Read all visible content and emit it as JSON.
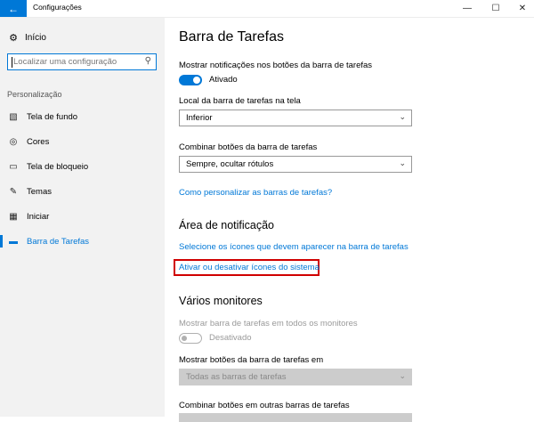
{
  "window": {
    "title": "Configurações",
    "back_icon": "←",
    "min_icon": "—",
    "max_icon": "☐",
    "close_icon": "✕"
  },
  "sidebar": {
    "home_label": "Início",
    "home_icon": "⚙",
    "search_placeholder": "Localizar uma configuração",
    "search_icon": "⚲",
    "section_label": "Personalização",
    "items": [
      {
        "label": "Tela de fundo",
        "icon": "▧",
        "icon_name": "picture-icon"
      },
      {
        "label": "Cores",
        "icon": "◎",
        "icon_name": "palette-icon"
      },
      {
        "label": "Tela de bloqueio",
        "icon": "▭",
        "icon_name": "lock-screen-icon"
      },
      {
        "label": "Temas",
        "icon": "✎",
        "icon_name": "brush-icon"
      },
      {
        "label": "Iniciar",
        "icon": "▦",
        "icon_name": "start-icon"
      },
      {
        "label": "Barra de Tarefas",
        "icon": "▬",
        "icon_name": "taskbar-icon",
        "active": true
      }
    ]
  },
  "main": {
    "title": "Barra de Tarefas",
    "badges_label": "Mostrar notificações nos botões da barra de tarefas",
    "badges_state": "Ativado",
    "location_label": "Local da barra de tarefas na tela",
    "location_value": "Inferior",
    "combine_label": "Combinar botões da barra de tarefas",
    "combine_value": "Sempre, ocultar rótulos",
    "customize_link": "Como personalizar as barras de tarefas?",
    "notif_heading": "Área de notificação",
    "select_icons_link": "Selecione os ícones que devem aparecer na barra de tarefas",
    "system_icons_link": "Ativar ou desativar ícones do sistema",
    "multi_heading": "Vários monitores",
    "show_all_label": "Mostrar barra de tarefas em todos os monitores",
    "show_all_state": "Desativado",
    "show_buttons_label": "Mostrar botões da barra de tarefas em",
    "show_buttons_value": "Todas as barras de tarefas",
    "combine_other_label": "Combinar botões em outras barras de tarefas",
    "chevron": "⌄"
  },
  "colors": {
    "accent": "#0078d7",
    "highlight_border": "#d00000",
    "sidebar_bg": "#f2f2f2"
  }
}
